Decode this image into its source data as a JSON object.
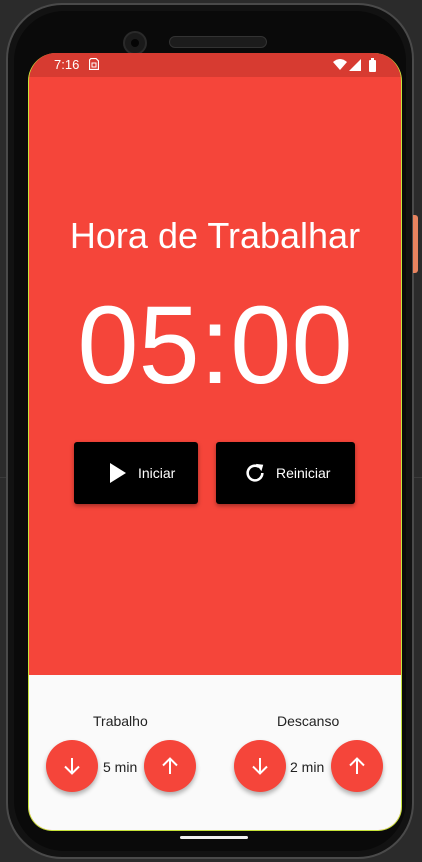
{
  "status_bar": {
    "time": "7:16",
    "icons": [
      "sim-card-icon",
      "wifi-icon",
      "signal-icon",
      "battery-icon"
    ]
  },
  "colors": {
    "primary": "#f5453a",
    "status_bar": "#d73b31",
    "button": "#000000",
    "panel": "#fafafa"
  },
  "timer": {
    "title": "Hora de Trabalhar",
    "display": "05:00"
  },
  "controls": {
    "start_label": "Iniciar",
    "start_icon": "play-icon",
    "reset_label": "Reiniciar",
    "reset_icon": "refresh-icon"
  },
  "settings": {
    "work": {
      "label": "Trabalho",
      "value": "5 min",
      "decrease_icon": "arrow-down-icon",
      "increase_icon": "arrow-up-icon"
    },
    "rest": {
      "label": "Descanso",
      "value": "2 min",
      "decrease_icon": "arrow-down-icon",
      "increase_icon": "arrow-up-icon"
    }
  }
}
